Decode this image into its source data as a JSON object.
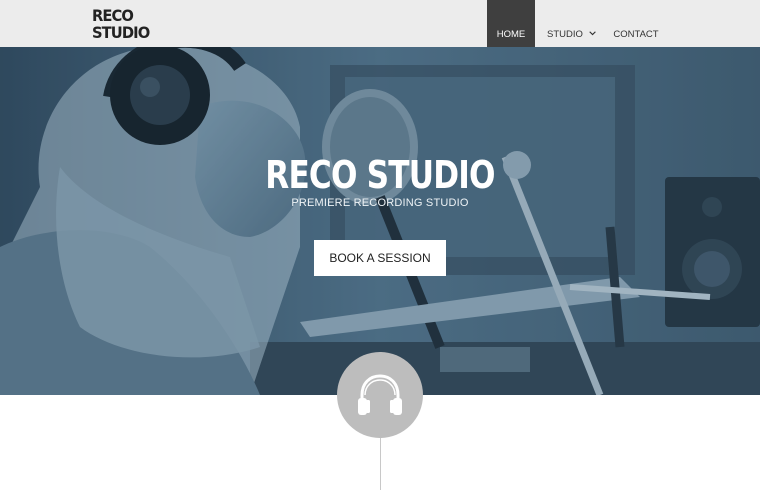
{
  "brand": {
    "line1": "RECO",
    "line2": "STUDIO"
  },
  "nav": {
    "home": "HOME",
    "studio": "STUDIO",
    "contact": "CONTACT"
  },
  "hero": {
    "title": "RECO STUDIO",
    "subtitle": "PREMIERE RECORDING STUDIO",
    "cta": "BOOK A SESSION"
  },
  "icons": {
    "studio_dropdown": "chevron-down-icon",
    "feature": "headphones-icon"
  },
  "colors": {
    "header_bg": "#ececec",
    "nav_active_bg": "#3f3f3f",
    "hero_tint": "#45637a",
    "circle_bg": "#bdbdbd"
  }
}
